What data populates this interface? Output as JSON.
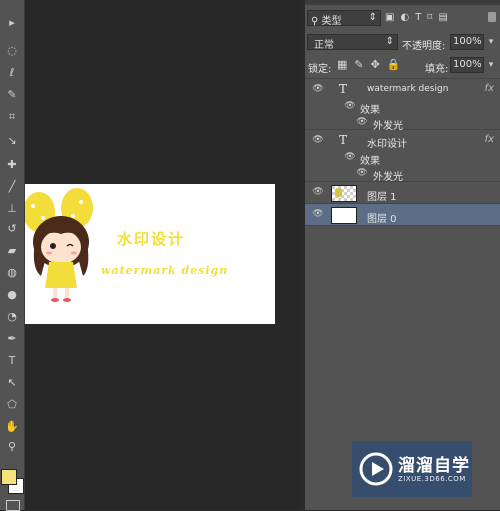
{
  "toolbar": {
    "tools": [
      {
        "icon": "move-icon",
        "glyph": "▸"
      },
      {
        "icon": "marquee-icon",
        "glyph": "◌"
      },
      {
        "icon": "lasso-icon",
        "glyph": "ℓ"
      },
      {
        "icon": "quick-select-icon",
        "glyph": "✎"
      },
      {
        "icon": "crop-icon",
        "glyph": "⌗"
      },
      {
        "icon": "eyedropper-icon",
        "glyph": "↘"
      },
      {
        "icon": "healing-icon",
        "glyph": "✚"
      },
      {
        "icon": "brush-icon",
        "glyph": "╱"
      },
      {
        "icon": "stamp-icon",
        "glyph": "⊥"
      },
      {
        "icon": "history-brush-icon",
        "glyph": "↺"
      },
      {
        "icon": "eraser-icon",
        "glyph": "▰"
      },
      {
        "icon": "paint-bucket-icon",
        "glyph": "◍"
      },
      {
        "icon": "blur-icon",
        "glyph": "●"
      },
      {
        "icon": "dodge-icon",
        "glyph": "◔"
      },
      {
        "icon": "pen-icon",
        "glyph": "✒"
      },
      {
        "icon": "type-icon",
        "glyph": "T"
      },
      {
        "icon": "path-select-icon",
        "glyph": "↖"
      },
      {
        "icon": "shape-icon",
        "glyph": "⬠"
      },
      {
        "icon": "hand-icon",
        "glyph": "✋"
      },
      {
        "icon": "zoom-icon",
        "glyph": "⚲"
      }
    ],
    "foreground_color": "#f5e27a",
    "background_color": "#ffffff"
  },
  "document": {
    "watermark_cn": "水印设计",
    "watermark_en": "watermark design"
  },
  "layers_panel": {
    "filter_label": "类型",
    "blend_mode": "正常",
    "opacity_label": "不透明度:",
    "opacity_value": "100%",
    "lock_label": "锁定:",
    "fill_label": "填充:",
    "fill_value": "100%",
    "layers": [
      {
        "name": "watermark design",
        "kind": "text",
        "effects_label": "效果",
        "effect": "外发光",
        "fx": "fx"
      },
      {
        "name": "水印设计",
        "kind": "text",
        "effects_label": "效果",
        "effect": "外发光",
        "fx": "fx"
      },
      {
        "name": "图层 1",
        "kind": "image"
      },
      {
        "name": "图层 0",
        "kind": "fill",
        "selected": true
      }
    ]
  },
  "watermark_logo": {
    "brand": "溜溜自学",
    "url": "ZIXUE.3D66.COM"
  },
  "colors": {
    "accent_yellow": "#f3de39",
    "selected_layer": "#5c6d86",
    "panel_bg": "#535353"
  }
}
